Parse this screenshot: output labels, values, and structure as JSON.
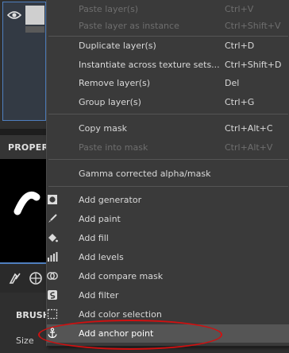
{
  "background": {
    "properties_title": "PROPERT",
    "brush_title": "BRUSH",
    "size_label": "Size",
    "icons": [
      "eye-icon",
      "brush-tab-icon",
      "material-tab-icon"
    ]
  },
  "menu": {
    "items": [
      {
        "label": "Paste layer(s)",
        "shortcut": "Ctrl+V",
        "disabled": true
      },
      {
        "label": "Paste layer as instance",
        "shortcut": "Ctrl+Shift+V",
        "disabled": true
      },
      {
        "label": "Duplicate layer(s)",
        "shortcut": "Ctrl+D"
      },
      {
        "label": "Instantiate across texture sets...",
        "shortcut": "Ctrl+Shift+D"
      },
      {
        "label": "Remove layer(s)",
        "shortcut": "Del"
      },
      {
        "label": "Group layer(s)",
        "shortcut": "Ctrl+G"
      },
      {
        "label": "Copy mask",
        "shortcut": "Ctrl+Alt+C"
      },
      {
        "label": "Paste into mask",
        "shortcut": "Ctrl+Alt+V",
        "disabled": true
      },
      {
        "label": "Gamma corrected alpha/mask"
      },
      {
        "label": "Add generator",
        "icon": "generator-icon"
      },
      {
        "label": "Add paint",
        "icon": "paint-brush-icon"
      },
      {
        "label": "Add fill",
        "icon": "fill-bucket-icon"
      },
      {
        "label": "Add levels",
        "icon": "levels-icon"
      },
      {
        "label": "Add compare mask",
        "icon": "compare-mask-icon"
      },
      {
        "label": "Add filter",
        "icon": "filter-icon"
      },
      {
        "label": "Add color selection",
        "icon": "color-selection-icon"
      },
      {
        "label": "Add anchor point",
        "icon": "anchor-icon",
        "highlighted": true
      }
    ]
  },
  "colors": {
    "menu_bg": "#3a3a3a",
    "highlight": "#555555",
    "selection_border": "#4f7fbf",
    "annotation": "#d01010",
    "disabled_text": "#6e6e6e"
  }
}
